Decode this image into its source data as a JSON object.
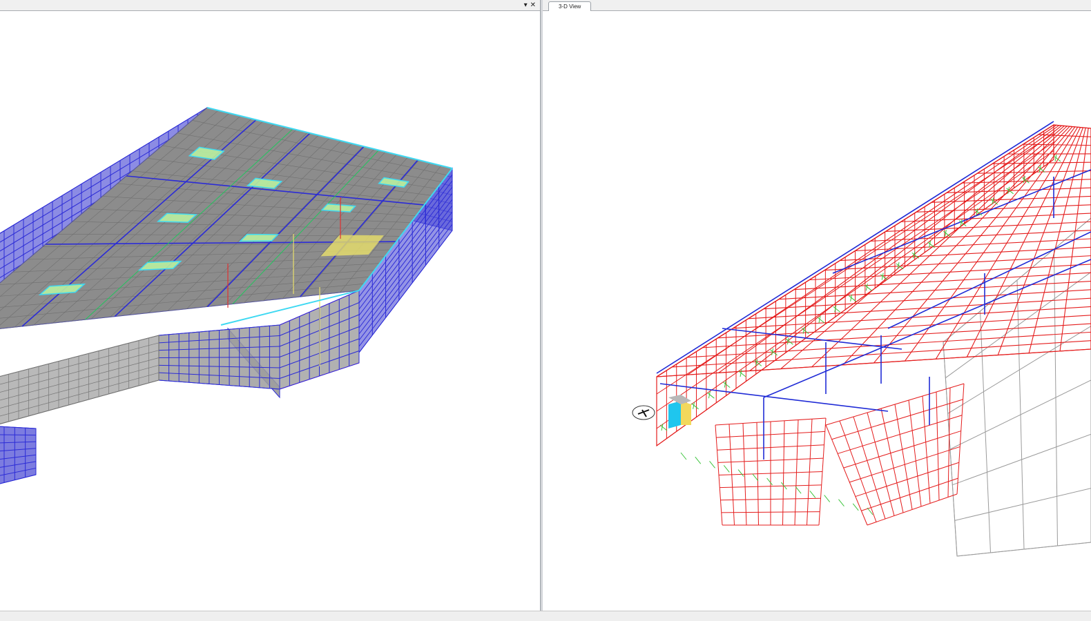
{
  "left_pane": {
    "tab_label": "",
    "controls": {
      "dropdown_icon": "caret-down-icon",
      "close_icon": "close-icon",
      "dropdown_glyph": "▾",
      "close_glyph": "✕"
    },
    "colors": {
      "frame": "#2b2bd6",
      "slab": "#8c8c8c",
      "wall": "#5b5bd8",
      "highlight": "#3fd9f2",
      "beam_green": "#22c55e",
      "beam_red": "#e03131",
      "accent_yellow": "#e8e06a"
    }
  },
  "right_pane": {
    "tab_label": "3-D View",
    "colors": {
      "frame_red": "#e41b1b",
      "frame_blue": "#1f2bd6",
      "support_green": "#3cc43c",
      "grid_grey": "#9a9a9a"
    }
  },
  "status_bar": {
    "text": ""
  }
}
